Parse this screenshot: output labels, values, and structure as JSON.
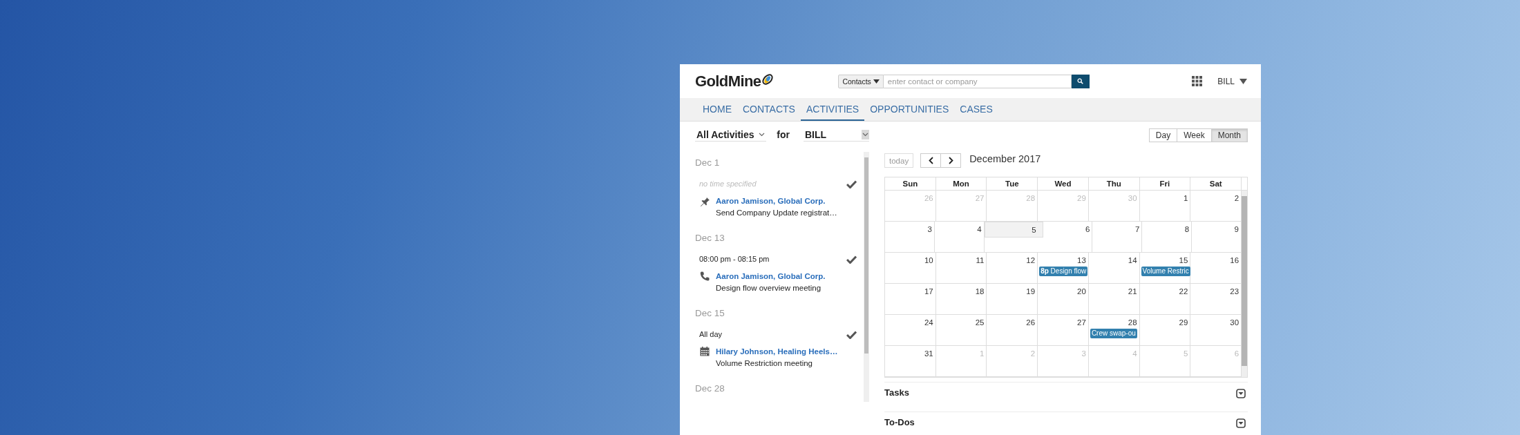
{
  "header": {
    "logo": "GoldMine",
    "search": {
      "scope": "Contacts",
      "placeholder": "enter contact or company"
    },
    "user": "BILL"
  },
  "nav": [
    {
      "label": "HOME",
      "selected": false
    },
    {
      "label": "CONTACTS",
      "selected": false
    },
    {
      "label": "ACTIVITIES",
      "selected": true
    },
    {
      "label": "OPPORTUNITIES",
      "selected": false
    },
    {
      "label": "CASES",
      "selected": false
    }
  ],
  "filters": {
    "activity": "All Activities",
    "for_label": "for",
    "user": "BILL"
  },
  "agenda": [
    {
      "date": "Dec 1",
      "activities": [
        {
          "time_specified": false,
          "time": "no time specified",
          "kind": "pin",
          "contact": "Aaron Jamison, Global Corp.",
          "description": "Send Company Update registrat…"
        }
      ]
    },
    {
      "date": "Dec 13",
      "activities": [
        {
          "time_specified": true,
          "time": "08:00 pm - 08:15 pm",
          "kind": "call",
          "contact": "Aaron Jamison, Global Corp.",
          "description": "Design flow overview meeting"
        }
      ]
    },
    {
      "date": "Dec 15",
      "activities": [
        {
          "time_specified": true,
          "time": "All day",
          "kind": "appointment",
          "contact": "Hilary Johnson, Healing Heels…",
          "description": "Volume Restriction meeting"
        }
      ]
    },
    {
      "date": "Dec 28"
    }
  ],
  "calendar": {
    "views": [
      {
        "label": "Day",
        "selected": false
      },
      {
        "label": "Week",
        "selected": false
      },
      {
        "label": "Month",
        "selected": true
      }
    ],
    "today_button": "today",
    "title": "December 2017",
    "weekdays": [
      "Sun",
      "Mon",
      "Tue",
      "Wed",
      "Thu",
      "Fri",
      "Sat"
    ],
    "weeks": [
      [
        {
          "day": "26",
          "other_month": true,
          "today": false
        },
        {
          "day": "27",
          "other_month": true,
          "today": false
        },
        {
          "day": "28",
          "other_month": true,
          "today": false
        },
        {
          "day": "29",
          "other_month": true,
          "today": false
        },
        {
          "day": "30",
          "other_month": true,
          "today": false
        },
        {
          "day": "1",
          "other_month": false,
          "today": false
        },
        {
          "day": "2",
          "other_month": false,
          "today": false
        }
      ],
      [
        {
          "day": "3",
          "other_month": false,
          "today": false
        },
        {
          "day": "4",
          "other_month": false,
          "today": false
        },
        {
          "day": "5",
          "other_month": false,
          "today": true
        },
        {
          "day": "6",
          "other_month": false,
          "today": false
        },
        {
          "day": "7",
          "other_month": false,
          "today": false
        },
        {
          "day": "8",
          "other_month": false,
          "today": false
        },
        {
          "day": "9",
          "other_month": false,
          "today": false
        }
      ],
      [
        {
          "day": "10",
          "other_month": false,
          "today": false
        },
        {
          "day": "11",
          "other_month": false,
          "today": false
        },
        {
          "day": "12",
          "other_month": false,
          "today": false
        },
        {
          "day": "13",
          "other_month": false,
          "today": false,
          "events": [
            "**8p** Design flow"
          ]
        },
        {
          "day": "14",
          "other_month": false,
          "today": false
        },
        {
          "day": "15",
          "other_month": false,
          "today": false,
          "events": [
            "Volume Restric"
          ]
        },
        {
          "day": "16",
          "other_month": false,
          "today": false
        }
      ],
      [
        {
          "day": "17",
          "other_month": false,
          "today": false
        },
        {
          "day": "18",
          "other_month": false,
          "today": false
        },
        {
          "day": "19",
          "other_month": false,
          "today": false
        },
        {
          "day": "20",
          "other_month": false,
          "today": false
        },
        {
          "day": "21",
          "other_month": false,
          "today": false
        },
        {
          "day": "22",
          "other_month": false,
          "today": false
        },
        {
          "day": "23",
          "other_month": false,
          "today": false
        }
      ],
      [
        {
          "day": "24",
          "other_month": false,
          "today": false
        },
        {
          "day": "25",
          "other_month": false,
          "today": false
        },
        {
          "day": "26",
          "other_month": false,
          "today": false
        },
        {
          "day": "27",
          "other_month": false,
          "today": false
        },
        {
          "day": "28",
          "other_month": false,
          "today": false,
          "events": [
            "Crew swap-ou"
          ]
        },
        {
          "day": "29",
          "other_month": false,
          "today": false
        },
        {
          "day": "30",
          "other_month": false,
          "today": false
        }
      ],
      [
        {
          "day": "31",
          "other_month": false,
          "today": false
        },
        {
          "day": "1",
          "other_month": true,
          "today": false
        },
        {
          "day": "2",
          "other_month": true,
          "today": false
        },
        {
          "day": "3",
          "other_month": true,
          "today": false
        },
        {
          "day": "4",
          "other_month": true,
          "today": false
        },
        {
          "day": "5",
          "other_month": true,
          "today": false
        },
        {
          "day": "6",
          "other_month": true,
          "today": false
        }
      ]
    ]
  },
  "sections": [
    {
      "title": "Tasks",
      "expanded": false
    },
    {
      "title": "To-Dos",
      "expanded": false
    }
  ]
}
